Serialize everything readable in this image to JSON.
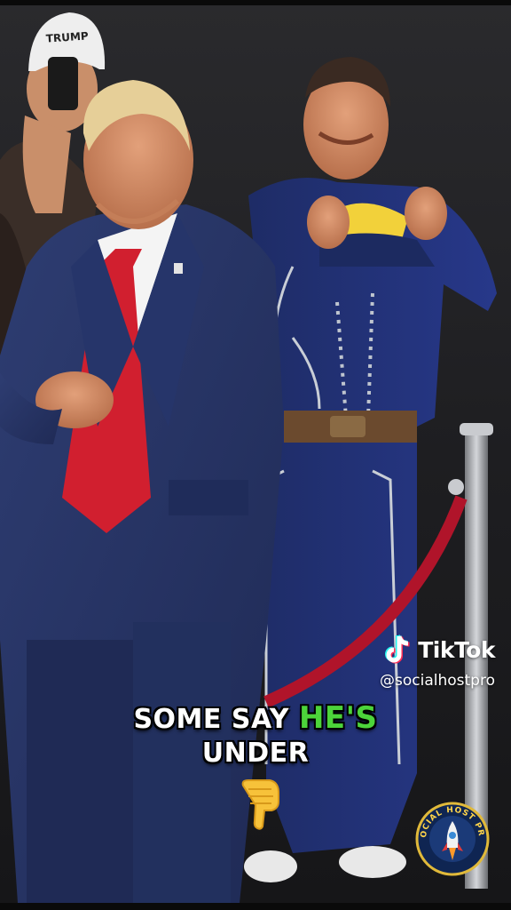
{
  "watermark": {
    "brand": "TikTok",
    "handle": "@socialhostpro"
  },
  "caption": {
    "line1_plain": "SOME SAY",
    "line1_highlight": "HE'S",
    "line2": "UNDER",
    "highlight_color": "#4cd43a",
    "emoji": "pointing-down-hand"
  },
  "badge": {
    "text": "SOCIAL HOST PRO",
    "icon": "rocket-icon"
  },
  "hat_text": "TRUMP"
}
